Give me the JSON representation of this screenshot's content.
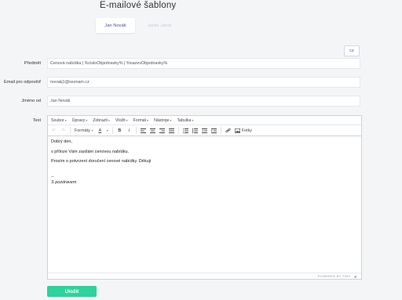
{
  "page": {
    "title": "E-mailové šablony"
  },
  "tabs": [
    {
      "label": "Jan Novák",
      "active": true
    },
    {
      "label": "Jarda Jaroš",
      "active": false
    }
  ],
  "language_button": "cz",
  "form": {
    "subject_label": "Předmět",
    "subject_value": "Cenová nabídka | %cisloObjednavky% | %nazevObjednavky%",
    "reply_label": "Email pro odpověď",
    "reply_value": "novakj1@seznam.cz",
    "from_label": "Jméno od",
    "from_value": "Jan Novák",
    "text_label": "Text"
  },
  "editor": {
    "menus": [
      "Soubor",
      "Úpravy",
      "Zobrazit",
      "Vložit",
      "Formát",
      "Nástroje",
      "Tabulka"
    ],
    "formats_label": "Formáty",
    "image_label": "Fotky",
    "paragraphs": [
      "Dobrý den,",
      "v příloze Vám zasílám cenovou nabídku.",
      "Prosím o potvrzení doručení cenové nabídky. Děkuji"
    ],
    "signature_dash": "--",
    "signature": "S pozdravem",
    "powered_by": "POWERED BY TINY"
  },
  "save_button": "Uložit",
  "colors": {
    "accent": "#3f51b5",
    "save": "#2ed39a"
  }
}
